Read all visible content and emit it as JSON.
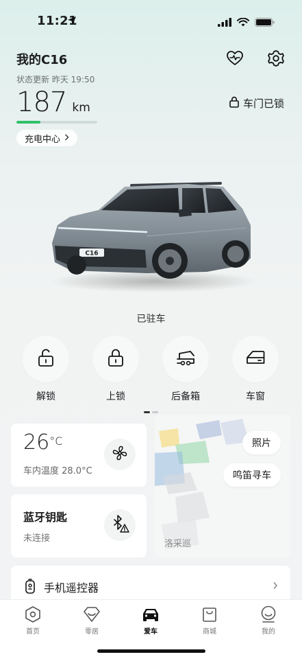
{
  "status_bar": {
    "time": "11:21"
  },
  "header": {
    "car_name": "我的C16",
    "status_update": "状态更新 昨天 19:50",
    "range_value": "187",
    "range_unit": "km",
    "range_level": 0.3,
    "door_status": "车门已锁",
    "charge_center": "充电中心"
  },
  "car": {
    "plate_text": "C16",
    "parking_status": "已驻车"
  },
  "quick_actions": [
    {
      "label": "解锁",
      "icon": "unlock-icon"
    },
    {
      "label": "上锁",
      "icon": "lock-icon"
    },
    {
      "label": "后备箱",
      "icon": "trunk-icon"
    },
    {
      "label": "车窗",
      "icon": "window-icon"
    }
  ],
  "climate": {
    "temp_value": "26",
    "temp_unit": "°C",
    "inside_temp": "车内温度  28.0°C"
  },
  "bluetooth_key": {
    "title": "蓝牙钥匙",
    "status": "未连接"
  },
  "photo_card": {
    "photo_btn": "照片",
    "horn_btn": "鸣笛寻车",
    "caption": "洛采巡"
  },
  "remote": {
    "label": "手机遥控器"
  },
  "tabbar": [
    {
      "label": "首页",
      "icon": "home-hex-icon",
      "active": false
    },
    {
      "label": "零居",
      "icon": "diamond-heart-icon",
      "active": false
    },
    {
      "label": "爱车",
      "icon": "car-icon",
      "active": true
    },
    {
      "label": "商城",
      "icon": "shopping-bag-icon",
      "active": false
    },
    {
      "label": "我的",
      "icon": "profile-icon",
      "active": false
    }
  ],
  "colors": {
    "accent_green": "#2fbf6a",
    "bg_mint": "#dcefeb",
    "car_body": "#8a949c"
  }
}
